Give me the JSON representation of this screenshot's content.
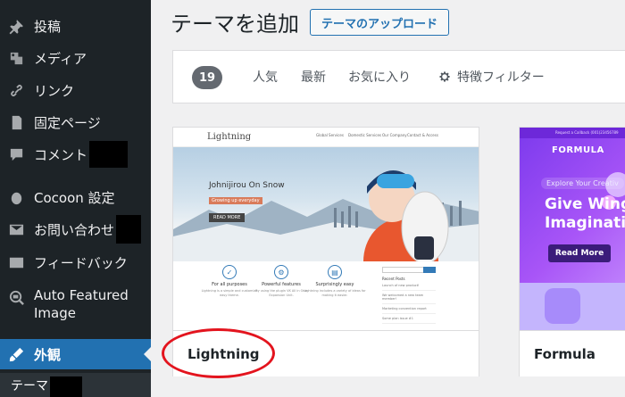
{
  "sidebar": {
    "items": [
      {
        "label": "投稿",
        "icon": "pin-icon"
      },
      {
        "label": "メディア",
        "icon": "media-icon"
      },
      {
        "label": "リンク",
        "icon": "link-icon"
      },
      {
        "label": "固定ページ",
        "icon": "page-icon"
      },
      {
        "label": "コメント",
        "icon": "comment-icon"
      },
      {
        "label": "Cocoon 設定",
        "icon": "cocoon-icon"
      },
      {
        "label": "お問い合わせ",
        "icon": "mail-icon"
      },
      {
        "label": "フィードバック",
        "icon": "feedback-icon"
      },
      {
        "label": "Auto Featured Image",
        "icon": "auto-featured-image-icon"
      },
      {
        "label": "外観",
        "icon": "appearance-icon",
        "active": true
      }
    ],
    "submenu_label": "テーマ"
  },
  "header": {
    "title": "テーマを追加",
    "upload_label": "テーマのアップロード"
  },
  "filter_bar": {
    "count": "19",
    "links": [
      "人気",
      "最新",
      "お気に入り"
    ],
    "feature_filter_label": "特徴フィルター"
  },
  "themes": [
    {
      "name": "Lightning",
      "preview": {
        "logo": "Lightning",
        "nav": [
          "Global Services",
          "Domestic Services",
          "Our Company",
          "Contact & Access"
        ],
        "hero_title": "Johnijirou On Snow",
        "hero_sub": "Growing up everyday",
        "hero_button": "READ MORE",
        "features": [
          {
            "title": "For all purposes",
            "desc": "Lightning is a simple and customize easy theme."
          },
          {
            "title": "Powerful features",
            "desc": "By using the plugin VK All in One Expansion Unit."
          },
          {
            "title": "Surprisingly easy",
            "desc": "Lightning includes a variety of ideas for making it easier."
          }
        ],
        "sidebar_title": "Recent Posts",
        "sidebar_search": "Search",
        "sidebar_posts": [
          "Launch of new product!",
          "We welcomed a new team member!",
          "Marketing convention report",
          "Some plan issue #1"
        ]
      }
    },
    {
      "name": "Formula",
      "preview": {
        "top_bar": "Request a Callback  (001)23456789",
        "logo": "FORMULA",
        "explore": "Explore Your Creativ",
        "heading_1": "Give Wing",
        "heading_2": "Imaginatio",
        "read_more": "Read More"
      }
    }
  ],
  "colors": {
    "sidebar_bg": "#1d2327",
    "active_bg": "#2271b1",
    "highlight_oval": "#e3141e",
    "formula_purple": "#7c3aed"
  }
}
